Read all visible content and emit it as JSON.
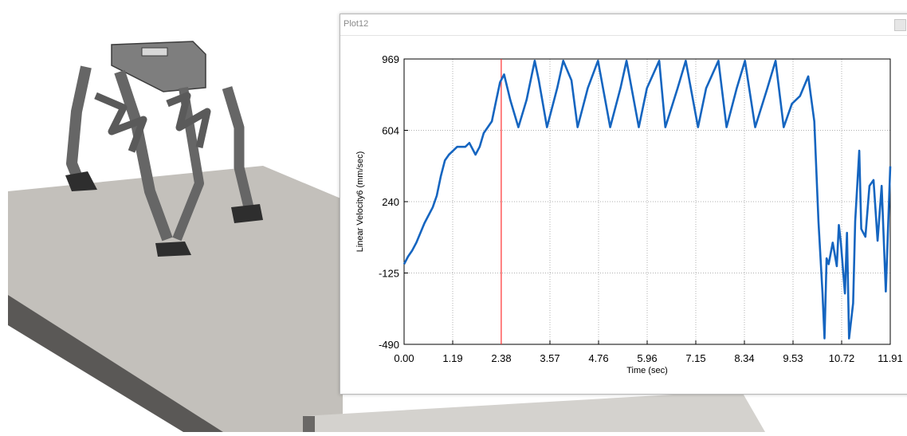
{
  "window": {
    "title": "Plot12"
  },
  "colors": {
    "series_line": "#1565c0",
    "cursor_line": "#ff3030",
    "grid": "#b0b0b0",
    "floor_top": "#c3c0bb",
    "floor_side": "#5a5856",
    "robot_body": "#6c6c6c"
  },
  "chart_data": {
    "type": "line",
    "title": "",
    "xlabel": "Time (sec)",
    "ylabel": "Linear Velocity6 (mm/sec)",
    "xlim": [
      0.0,
      11.91
    ],
    "ylim": [
      -490,
      969
    ],
    "x_tick_labels": [
      "0.00",
      "1.19",
      "2.38",
      "3.57",
      "4.76",
      "5.96",
      "7.15",
      "8.34",
      "9.53",
      "10.72",
      "11.91"
    ],
    "y_tick_labels": [
      "969",
      "604",
      "240",
      "-125",
      "-490"
    ],
    "grid": true,
    "cursor_x": 2.38,
    "series": [
      {
        "x": [
          0.0,
          0.1,
          0.2,
          0.3,
          0.4,
          0.5,
          0.6,
          0.7,
          0.8,
          0.9,
          1.0,
          1.1,
          1.2,
          1.3,
          1.4,
          1.5,
          1.6,
          1.75,
          1.85,
          1.95,
          2.05,
          2.15,
          2.25,
          2.35,
          2.45,
          2.6,
          2.8,
          3.0,
          3.2,
          3.3,
          3.5,
          3.75,
          3.9,
          4.1,
          4.25,
          4.5,
          4.75,
          5.05,
          5.3,
          5.45,
          5.75,
          5.95,
          6.25,
          6.4,
          6.7,
          6.9,
          7.2,
          7.4,
          7.7,
          7.9,
          8.15,
          8.35,
          8.6,
          8.9,
          9.1,
          9.3,
          9.5,
          9.7,
          9.9,
          10.05,
          10.15,
          10.25,
          10.3,
          10.35,
          10.4,
          10.5,
          10.6,
          10.65,
          10.7,
          10.8,
          10.85,
          10.9,
          11.0,
          11.05,
          11.15,
          11.2,
          11.3,
          11.4,
          11.5,
          11.6,
          11.7,
          11.8,
          11.91
        ],
        "y": [
          -80,
          -40,
          -10,
          30,
          80,
          130,
          170,
          210,
          270,
          370,
          450,
          480,
          500,
          520,
          520,
          520,
          540,
          480,
          520,
          590,
          620,
          650,
          750,
          850,
          890,
          760,
          620,
          760,
          960,
          860,
          620,
          820,
          960,
          860,
          620,
          820,
          960,
          620,
          820,
          960,
          620,
          820,
          960,
          620,
          820,
          960,
          620,
          820,
          960,
          620,
          820,
          960,
          620,
          820,
          960,
          620,
          740,
          780,
          880,
          650,
          140,
          -230,
          -460,
          -50,
          -80,
          30,
          -90,
          120,
          30,
          -230,
          80,
          -460,
          -280,
          140,
          500,
          100,
          60,
          320,
          350,
          40,
          320,
          -220,
          420
        ]
      }
    ]
  }
}
